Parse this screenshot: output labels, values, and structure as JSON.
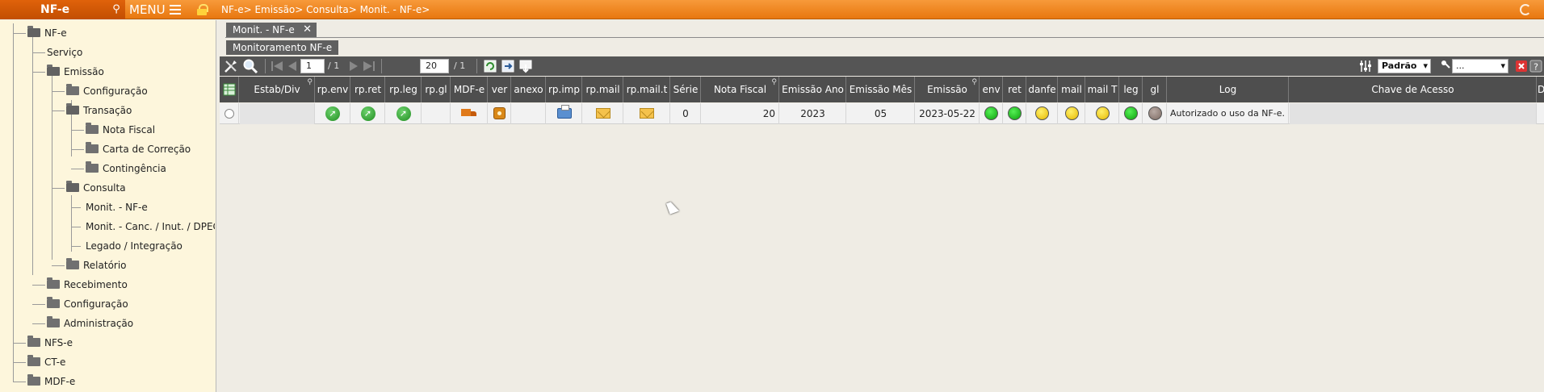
{
  "topbar": {
    "brand": "NF-e",
    "menu_label": "MENU",
    "breadcrumb": "NF-e> Emissão> Consulta> Monit. - NF-e>"
  },
  "sidebar": {
    "items": [
      {
        "label": "NF-e",
        "type": "folder-open"
      },
      {
        "label": "Serviço",
        "type": "leaf"
      },
      {
        "label": "Emissão",
        "type": "folder-open"
      },
      {
        "label": "Configuração",
        "type": "folder"
      },
      {
        "label": "Transação",
        "type": "folder-open"
      },
      {
        "label": "Nota Fiscal",
        "type": "folder"
      },
      {
        "label": "Carta de Correção",
        "type": "folder"
      },
      {
        "label": "Contingência",
        "type": "folder"
      },
      {
        "label": "Consulta",
        "type": "folder-open"
      },
      {
        "label": "Monit. - NF-e",
        "type": "leaf"
      },
      {
        "label": "Monit. - Canc. / Inut. / DPEC /",
        "type": "leaf"
      },
      {
        "label": "Legado / Integração",
        "type": "leaf"
      },
      {
        "label": "Relatório",
        "type": "folder"
      },
      {
        "label": "Recebimento",
        "type": "folder"
      },
      {
        "label": "Configuração",
        "type": "folder"
      },
      {
        "label": "Administração",
        "type": "folder"
      },
      {
        "label": "NFS-e",
        "type": "folder"
      },
      {
        "label": "CT-e",
        "type": "folder"
      },
      {
        "label": "MDF-e",
        "type": "folder"
      }
    ]
  },
  "tabs": {
    "active_tab": "Monit. - NF-e",
    "close_glyph": "✕",
    "panel_title": "Monitoramento NF-e"
  },
  "toolbar": {
    "page_current": "1",
    "page_total": "/ 1",
    "page_size": "20",
    "page_size_total": "/ 1",
    "view_select": "Padrão",
    "filter_select": "..."
  },
  "grid": {
    "columns": [
      "Estab/Div",
      "rp.env",
      "rp.ret",
      "rp.leg",
      "rp.gl",
      "MDF-e",
      "ver",
      "anexo",
      "rp.imp",
      "rp.mail",
      "rp.mail.t",
      "Série",
      "Nota Fiscal",
      "Emissão Ano",
      "Emissão Mês",
      "Emissão",
      "env",
      "ret",
      "danfe",
      "mail",
      "mail T",
      "leg",
      "gl",
      "Log",
      "Chave de Acesso",
      "D"
    ],
    "row": {
      "serie": "0",
      "nota_fiscal": "20",
      "emissao_ano": "2023",
      "emissao_mes": "05",
      "emissao": "2023-05-22",
      "log": "Autorizado o uso da NF-e."
    }
  },
  "colors": {
    "accent": "#e8770f",
    "status_green": "#0ca10c",
    "status_yellow": "#e6b800",
    "status_grey": "#7d6a62"
  }
}
